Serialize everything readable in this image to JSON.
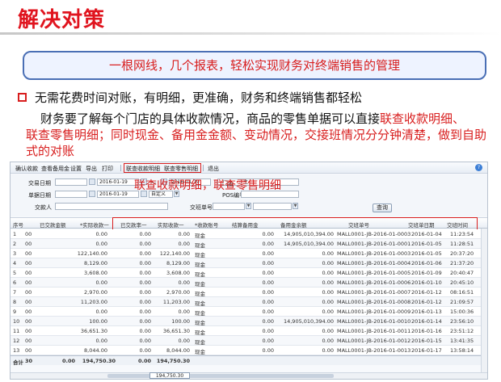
{
  "slide": {
    "title": "解决对策",
    "banner": "一根网线，几个报表，轻松实现财务对终端销售的管理",
    "bullet": "无需花费时间对账，有明细，更准确，财务和终端销售都轻松",
    "para_normal": "财务要了解每个门店的具体收款情况，商品的零售单据可以直接",
    "para_red_1": "联查收款明细、",
    "para_red_2": "联查零售明细；同时现金、备用金金额、变动情况，交接班情况分分钟清楚，做到自助式的对账",
    "overlay_label": "联查收款明细，联查零售明细",
    "accent": "#d81e1e",
    "banner_border": "#4a6fb5"
  },
  "toolbar": {
    "items": [
      "确认收款",
      "查看备用金",
      "设置",
      "导出",
      "打印",
      "联查收款明细",
      "联查零售明细",
      "退出"
    ]
  },
  "filters": {
    "label_trade_date": "交易日期",
    "date_start": "2016-01-19",
    "label_to": "～",
    "date_end": "2016-01-19",
    "label_store": "门店",
    "store_value": "主",
    "label_doc_date": "单据日期",
    "doc_start": "2016-01-19",
    "doc_end": "2016-01-19",
    "custom": "自定义",
    "label_pos": "POS编号",
    "label_payer": "交款人",
    "label_doc_no": "交班单号",
    "query_button": "查询"
  },
  "grid": {
    "headers": [
      "序号",
      "已交款金额",
      "*实际收款一",
      "已交款率一",
      "实际收款一",
      "*收款账号",
      "结算备用金",
      "备用金余额",
      "交班单号",
      "交班单日期",
      "交班时间"
    ],
    "rows": [
      [
        "1",
        "00",
        "0.00",
        "0.00",
        "0.00",
        "现金",
        "0.00",
        "14,905,010,394.00",
        "MALL0001-JB-2016-01-0003",
        "2016-01-04",
        "11:23:54"
      ],
      [
        "2",
        "00",
        "0.00",
        "0.00",
        "0.00",
        "现金",
        "0.00",
        "14,905,010,394.00",
        "MALL0001-JB-2016-01-0001",
        "2016-01-05",
        "11:28:51"
      ],
      [
        "3",
        "00",
        "122,140.00",
        "0.00",
        "122,140.00",
        "现金",
        "0.00",
        "0.00",
        "MALL0001-JB-2016-01-0003",
        "2016-01-05",
        "20:37:20"
      ],
      [
        "4",
        "00",
        "8,129.00",
        "0.00",
        "8,129.00",
        "现金",
        "0.00",
        "0.00",
        "MALL0001-JB-2016-01-0004",
        "2016-01-06",
        "21:37:20"
      ],
      [
        "5",
        "00",
        "3,608.00",
        "0.00",
        "3,608.00",
        "现金",
        "0.00",
        "0.00",
        "MALL0001-JB-2016-01-0005",
        "2016-01-09",
        "20:40:47"
      ],
      [
        "6",
        "00",
        "0.00",
        "0.00",
        "0.00",
        "现金",
        "0.00",
        "0.00",
        "MALL0001-JB-2016-01-0006",
        "2016-01-10",
        "20:45:10"
      ],
      [
        "7",
        "00",
        "2,970.00",
        "0.00",
        "2,970.00",
        "现金",
        "0.00",
        "0.00",
        "MALL0001-JB-2016-01-0007",
        "2016-01-12",
        "08:16:51"
      ],
      [
        "8",
        "00",
        "11,203.00",
        "0.00",
        "11,203.00",
        "现金",
        "0.00",
        "0.00",
        "MALL0001-JB-2016-01-0008",
        "2016-01-12",
        "21:09:57"
      ],
      [
        "9",
        "00",
        "0.00",
        "0.00",
        "0.00",
        "现金",
        "0.00",
        "0.00",
        "MALL0001-JB-2016-01-0009",
        "2016-01-13",
        "15:00:36"
      ],
      [
        "10",
        "00",
        "100.00",
        "0.00",
        "100.00",
        "现金",
        "0.00",
        "14,905,010,394.00",
        "MALL0001-JB-2016-01-0010",
        "2016-01-14",
        "23:56:10"
      ],
      [
        "11",
        "00",
        "36,651.30",
        "0.00",
        "36,651.30",
        "现金",
        "0.00",
        "0.00",
        "MALL0001-JB-2016-01-0011",
        "2016-01-16",
        "23:51:12"
      ],
      [
        "12",
        "00",
        "0.00",
        "0.00",
        "0.00",
        "现金",
        "0.00",
        "0.00",
        "MALL0001-JB-2016-01-0012",
        "2016-01-15",
        "13:41:35"
      ],
      [
        "13",
        "00",
        "8,044.00",
        "0.00",
        "8,044.00",
        "现金",
        "0.00",
        "0.00",
        "MALL0001-JB-2016-01-0013",
        "2016-01-17",
        "13:58:14"
      ]
    ],
    "total": [
      "合计",
      "30",
      "0.00",
      "194,750.30",
      "0.00",
      "194,750.30"
    ],
    "sum_popup": "194,750.30"
  }
}
